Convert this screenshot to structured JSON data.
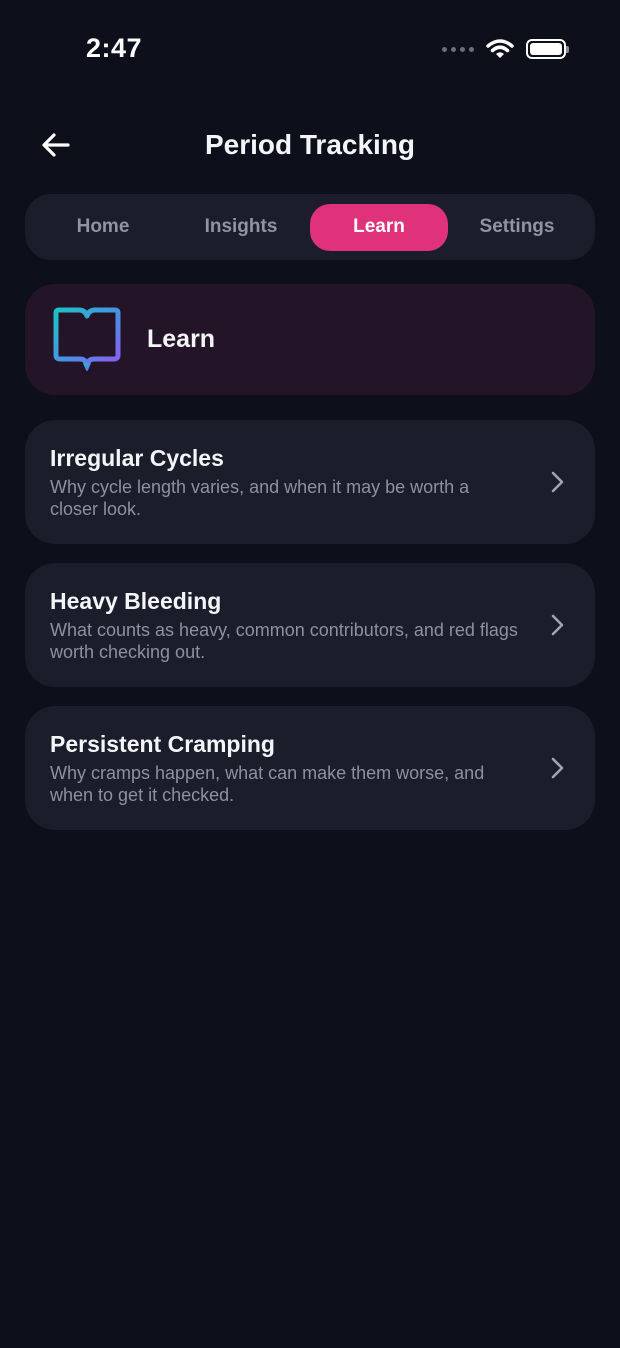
{
  "status_bar": {
    "time": "2:47"
  },
  "header": {
    "title": "Period Tracking",
    "back_icon": "arrow-left-icon"
  },
  "tabs": [
    {
      "label": "Home",
      "active": false
    },
    {
      "label": "Insights",
      "active": false
    },
    {
      "label": "Learn",
      "active": true
    },
    {
      "label": "Settings",
      "active": false
    }
  ],
  "learn_header": {
    "icon": "open-book-icon",
    "title": "Learn"
  },
  "articles": [
    {
      "title": "Irregular Cycles",
      "description": "Why cycle length varies, and when it may be worth a closer look."
    },
    {
      "title": "Heavy Bleeding",
      "description": "What counts as heavy, common contributors, and red flags worth checking out."
    },
    {
      "title": "Persistent Cramping",
      "description": "Why cramps happen, what can make them worse, and when to get it checked."
    }
  ],
  "colors": {
    "background": "#0d0f1b",
    "card": "#1b1d2b",
    "accent": "#e0327a",
    "learn_card": "#231427",
    "muted_text": "#8c90a0"
  }
}
